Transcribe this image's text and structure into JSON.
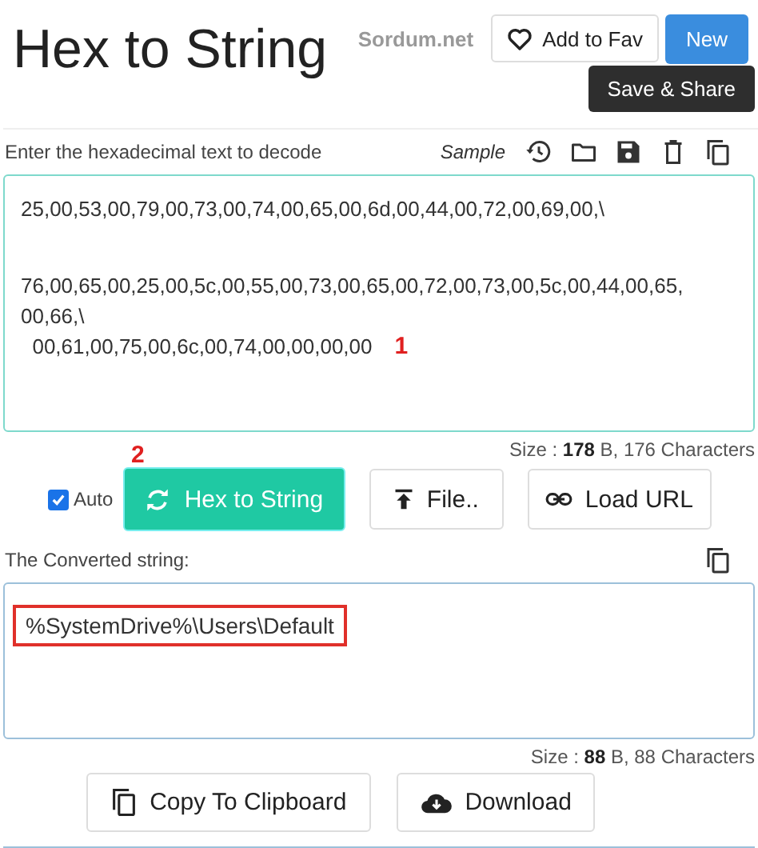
{
  "header": {
    "title": "Hex to String",
    "site": "Sordum.net",
    "fav_button": "Add to Fav",
    "new_button": "New",
    "tooltip": "Save & Share"
  },
  "input": {
    "label": "Enter the hexadecimal text to decode",
    "sample_link": "Sample",
    "lines": [
      "25,00,53,00,79,00,73,00,74,00,65,00,6d,00,44,00,72,00,69,00,\\",
      "76,00,65,00,25,00,5c,00,55,00,73,00,65,00,72,00,73,00,5c,00,44,00,65,",
      "00,66,\\",
      "  00,61,00,75,00,6c,00,74,00,00,00,00"
    ],
    "annotation": "1",
    "size_label": "Size : ",
    "size_value": "178",
    "size_rest": " B, 176 Characters"
  },
  "controls": {
    "auto": {
      "label": "Auto",
      "checked": true
    },
    "annotation": "2",
    "convert_button": "Hex to String",
    "file_button": "File..",
    "url_button": "Load URL"
  },
  "output": {
    "label": "The Converted string:",
    "value": "%SystemDrive%\\Users\\Default",
    "highlighted": true,
    "size_label": "Size : ",
    "size_value": "88",
    "size_rest": " B, 88 Characters"
  },
  "actions": {
    "copy_button": "Copy To Clipboard",
    "download_button": "Download"
  }
}
